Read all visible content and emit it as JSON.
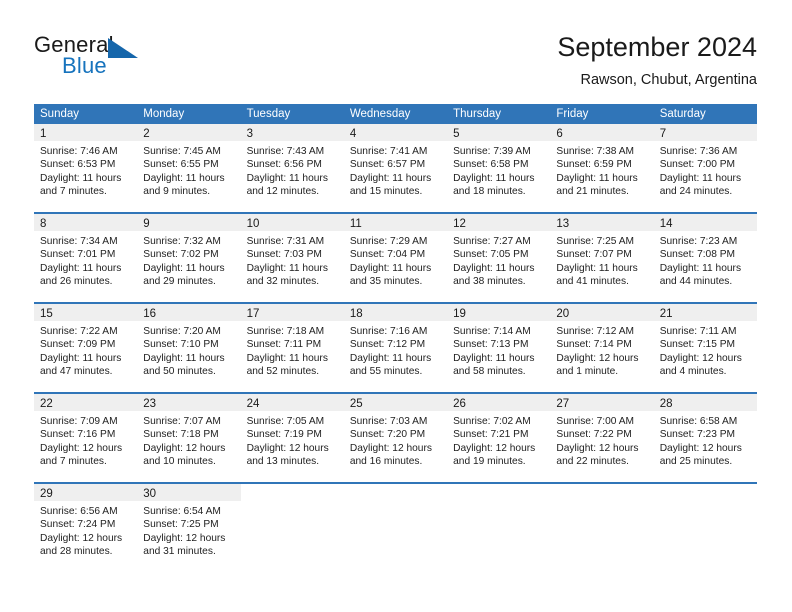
{
  "brand": {
    "name_part1": "General",
    "name_part2": "Blue",
    "triangle_icon": "triangle-logo-icon",
    "accent_color": "#1566ab"
  },
  "header": {
    "title": "September 2024",
    "location": "Rawson, Chubut, Argentina"
  },
  "theme": {
    "header_blue": "#3075b8",
    "daynum_band": "#efefef",
    "text": "#1a1a1a"
  },
  "calendar": {
    "weekdays": [
      "Sunday",
      "Monday",
      "Tuesday",
      "Wednesday",
      "Thursday",
      "Friday",
      "Saturday"
    ],
    "weeks": [
      {
        "days": [
          {
            "num": "1",
            "sunrise": "Sunrise: 7:46 AM",
            "sunset": "Sunset: 6:53 PM",
            "daylight1": "Daylight: 11 hours",
            "daylight2": "and 7 minutes."
          },
          {
            "num": "2",
            "sunrise": "Sunrise: 7:45 AM",
            "sunset": "Sunset: 6:55 PM",
            "daylight1": "Daylight: 11 hours",
            "daylight2": "and 9 minutes."
          },
          {
            "num": "3",
            "sunrise": "Sunrise: 7:43 AM",
            "sunset": "Sunset: 6:56 PM",
            "daylight1": "Daylight: 11 hours",
            "daylight2": "and 12 minutes."
          },
          {
            "num": "4",
            "sunrise": "Sunrise: 7:41 AM",
            "sunset": "Sunset: 6:57 PM",
            "daylight1": "Daylight: 11 hours",
            "daylight2": "and 15 minutes."
          },
          {
            "num": "5",
            "sunrise": "Sunrise: 7:39 AM",
            "sunset": "Sunset: 6:58 PM",
            "daylight1": "Daylight: 11 hours",
            "daylight2": "and 18 minutes."
          },
          {
            "num": "6",
            "sunrise": "Sunrise: 7:38 AM",
            "sunset": "Sunset: 6:59 PM",
            "daylight1": "Daylight: 11 hours",
            "daylight2": "and 21 minutes."
          },
          {
            "num": "7",
            "sunrise": "Sunrise: 7:36 AM",
            "sunset": "Sunset: 7:00 PM",
            "daylight1": "Daylight: 11 hours",
            "daylight2": "and 24 minutes."
          }
        ]
      },
      {
        "days": [
          {
            "num": "8",
            "sunrise": "Sunrise: 7:34 AM",
            "sunset": "Sunset: 7:01 PM",
            "daylight1": "Daylight: 11 hours",
            "daylight2": "and 26 minutes."
          },
          {
            "num": "9",
            "sunrise": "Sunrise: 7:32 AM",
            "sunset": "Sunset: 7:02 PM",
            "daylight1": "Daylight: 11 hours",
            "daylight2": "and 29 minutes."
          },
          {
            "num": "10",
            "sunrise": "Sunrise: 7:31 AM",
            "sunset": "Sunset: 7:03 PM",
            "daylight1": "Daylight: 11 hours",
            "daylight2": "and 32 minutes."
          },
          {
            "num": "11",
            "sunrise": "Sunrise: 7:29 AM",
            "sunset": "Sunset: 7:04 PM",
            "daylight1": "Daylight: 11 hours",
            "daylight2": "and 35 minutes."
          },
          {
            "num": "12",
            "sunrise": "Sunrise: 7:27 AM",
            "sunset": "Sunset: 7:05 PM",
            "daylight1": "Daylight: 11 hours",
            "daylight2": "and 38 minutes."
          },
          {
            "num": "13",
            "sunrise": "Sunrise: 7:25 AM",
            "sunset": "Sunset: 7:07 PM",
            "daylight1": "Daylight: 11 hours",
            "daylight2": "and 41 minutes."
          },
          {
            "num": "14",
            "sunrise": "Sunrise: 7:23 AM",
            "sunset": "Sunset: 7:08 PM",
            "daylight1": "Daylight: 11 hours",
            "daylight2": "and 44 minutes."
          }
        ]
      },
      {
        "days": [
          {
            "num": "15",
            "sunrise": "Sunrise: 7:22 AM",
            "sunset": "Sunset: 7:09 PM",
            "daylight1": "Daylight: 11 hours",
            "daylight2": "and 47 minutes."
          },
          {
            "num": "16",
            "sunrise": "Sunrise: 7:20 AM",
            "sunset": "Sunset: 7:10 PM",
            "daylight1": "Daylight: 11 hours",
            "daylight2": "and 50 minutes."
          },
          {
            "num": "17",
            "sunrise": "Sunrise: 7:18 AM",
            "sunset": "Sunset: 7:11 PM",
            "daylight1": "Daylight: 11 hours",
            "daylight2": "and 52 minutes."
          },
          {
            "num": "18",
            "sunrise": "Sunrise: 7:16 AM",
            "sunset": "Sunset: 7:12 PM",
            "daylight1": "Daylight: 11 hours",
            "daylight2": "and 55 minutes."
          },
          {
            "num": "19",
            "sunrise": "Sunrise: 7:14 AM",
            "sunset": "Sunset: 7:13 PM",
            "daylight1": "Daylight: 11 hours",
            "daylight2": "and 58 minutes."
          },
          {
            "num": "20",
            "sunrise": "Sunrise: 7:12 AM",
            "sunset": "Sunset: 7:14 PM",
            "daylight1": "Daylight: 12 hours",
            "daylight2": "and 1 minute."
          },
          {
            "num": "21",
            "sunrise": "Sunrise: 7:11 AM",
            "sunset": "Sunset: 7:15 PM",
            "daylight1": "Daylight: 12 hours",
            "daylight2": "and 4 minutes."
          }
        ]
      },
      {
        "days": [
          {
            "num": "22",
            "sunrise": "Sunrise: 7:09 AM",
            "sunset": "Sunset: 7:16 PM",
            "daylight1": "Daylight: 12 hours",
            "daylight2": "and 7 minutes."
          },
          {
            "num": "23",
            "sunrise": "Sunrise: 7:07 AM",
            "sunset": "Sunset: 7:18 PM",
            "daylight1": "Daylight: 12 hours",
            "daylight2": "and 10 minutes."
          },
          {
            "num": "24",
            "sunrise": "Sunrise: 7:05 AM",
            "sunset": "Sunset: 7:19 PM",
            "daylight1": "Daylight: 12 hours",
            "daylight2": "and 13 minutes."
          },
          {
            "num": "25",
            "sunrise": "Sunrise: 7:03 AM",
            "sunset": "Sunset: 7:20 PM",
            "daylight1": "Daylight: 12 hours",
            "daylight2": "and 16 minutes."
          },
          {
            "num": "26",
            "sunrise": "Sunrise: 7:02 AM",
            "sunset": "Sunset: 7:21 PM",
            "daylight1": "Daylight: 12 hours",
            "daylight2": "and 19 minutes."
          },
          {
            "num": "27",
            "sunrise": "Sunrise: 7:00 AM",
            "sunset": "Sunset: 7:22 PM",
            "daylight1": "Daylight: 12 hours",
            "daylight2": "and 22 minutes."
          },
          {
            "num": "28",
            "sunrise": "Sunrise: 6:58 AM",
            "sunset": "Sunset: 7:23 PM",
            "daylight1": "Daylight: 12 hours",
            "daylight2": "and 25 minutes."
          }
        ]
      },
      {
        "days": [
          {
            "num": "29",
            "sunrise": "Sunrise: 6:56 AM",
            "sunset": "Sunset: 7:24 PM",
            "daylight1": "Daylight: 12 hours",
            "daylight2": "and 28 minutes."
          },
          {
            "num": "30",
            "sunrise": "Sunrise: 6:54 AM",
            "sunset": "Sunset: 7:25 PM",
            "daylight1": "Daylight: 12 hours",
            "daylight2": "and 31 minutes."
          },
          {
            "num": "",
            "sunrise": "",
            "sunset": "",
            "daylight1": "",
            "daylight2": ""
          },
          {
            "num": "",
            "sunrise": "",
            "sunset": "",
            "daylight1": "",
            "daylight2": ""
          },
          {
            "num": "",
            "sunrise": "",
            "sunset": "",
            "daylight1": "",
            "daylight2": ""
          },
          {
            "num": "",
            "sunrise": "",
            "sunset": "",
            "daylight1": "",
            "daylight2": ""
          },
          {
            "num": "",
            "sunrise": "",
            "sunset": "",
            "daylight1": "",
            "daylight2": ""
          }
        ]
      }
    ]
  }
}
